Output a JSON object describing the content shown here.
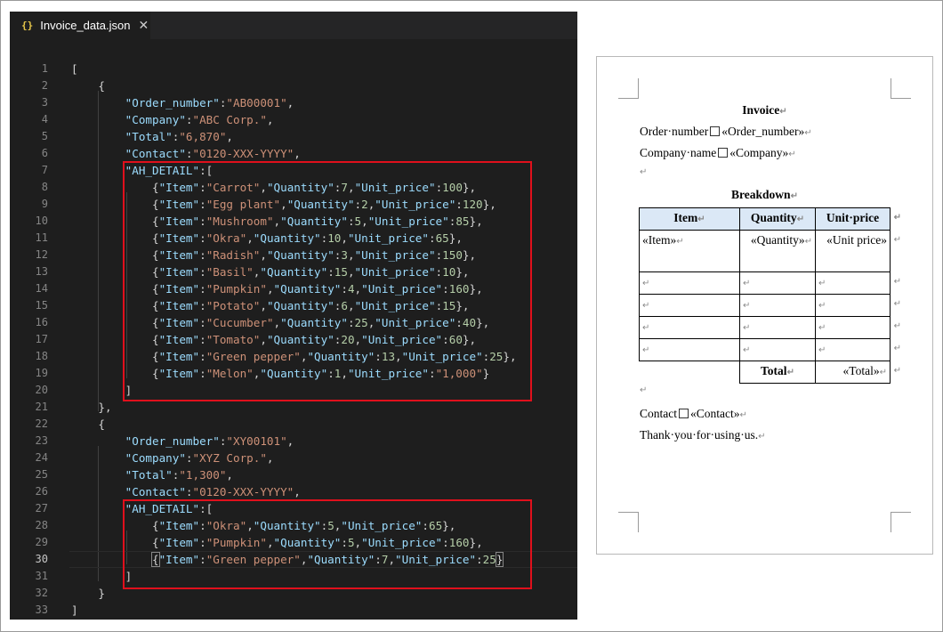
{
  "editor": {
    "tab": {
      "icon": "{}",
      "icon_name": "json-file-icon",
      "label": "Invoice_data.json",
      "close": "✕"
    },
    "current_line": 30,
    "line_numbers": [
      "1",
      "2",
      "3",
      "4",
      "5",
      "6",
      "7",
      "8",
      "9",
      "10",
      "11",
      "12",
      "13",
      "14",
      "15",
      "16",
      "17",
      "18",
      "19",
      "20",
      "21",
      "22",
      "23",
      "24",
      "25",
      "26",
      "27",
      "28",
      "29",
      "30",
      "31",
      "32",
      "33"
    ],
    "lines": [
      "[",
      "    {",
      "        \"Order_number\":\"AB00001\",",
      "        \"Company\":\"ABC Corp.\",",
      "        \"Total\":\"6,870\",",
      "        \"Contact\":\"0120-XXX-YYYY\",",
      "        \"AH_DETAIL\":[",
      "            {\"Item\":\"Carrot\",\"Quantity\":7,\"Unit_price\":100},",
      "            {\"Item\":\"Egg plant\",\"Quantity\":2,\"Unit_price\":120},",
      "            {\"Item\":\"Mushroom\",\"Quantity\":5,\"Unit_price\":85},",
      "            {\"Item\":\"Okra\",\"Quantity\":10,\"Unit_price\":65},",
      "            {\"Item\":\"Radish\",\"Quantity\":3,\"Unit_price\":150},",
      "            {\"Item\":\"Basil\",\"Quantity\":15,\"Unit_price\":10},",
      "            {\"Item\":\"Pumpkin\",\"Quantity\":4,\"Unit_price\":160},",
      "            {\"Item\":\"Potato\",\"Quantity\":6,\"Unit_price\":15},",
      "            {\"Item\":\"Cucumber\",\"Quantity\":25,\"Unit_price\":40},",
      "            {\"Item\":\"Tomato\",\"Quantity\":20,\"Unit_price\":60},",
      "            {\"Item\":\"Green pepper\",\"Quantity\":13,\"Unit_price\":25},",
      "            {\"Item\":\"Melon\",\"Quantity\":1,\"Unit_price\":\"1,000\"}",
      "        ]",
      "    },",
      "    {",
      "        \"Order_number\":\"XY00101\",",
      "        \"Company\":\"XYZ Corp.\",",
      "        \"Total\":\"1,300\",",
      "        \"Contact\":\"0120-XXX-YYYY\",",
      "        \"AH_DETAIL\":[",
      "            {\"Item\":\"Okra\",\"Quantity\":5,\"Unit_price\":65},",
      "            {\"Item\":\"Pumpkin\",\"Quantity\":5,\"Unit_price\":160},",
      "            {\"Item\":\"Green pepper\",\"Quantity\":7,\"Unit_price\":25}",
      "        ]",
      "    }",
      "]"
    ]
  },
  "document": {
    "title": "Invoice",
    "order_label": "Order·number",
    "order_field": "«Order_number»",
    "company_label": "Company·name",
    "company_field": "«Company»",
    "breakdown_title": "Breakdown",
    "table_headers": [
      "Item",
      "Quantity",
      "Unit·price"
    ],
    "field_row": [
      "«Item»",
      "«Quantity»",
      "«Unit price»"
    ],
    "total_label": "Total",
    "total_field": "«Total»",
    "contact_label": "Contact",
    "contact_field": "«Contact»",
    "thanks": "Thank·you·for·using·us.",
    "paragraph_mark": "↵"
  },
  "colors": {
    "editor_bg": "#1e1e1e",
    "json_key": "#9cdcfe",
    "json_string": "#ce9178",
    "json_number": "#b5cea8",
    "highlight_box": "#e0101c",
    "table_header_bg": "#dbe8f6"
  }
}
